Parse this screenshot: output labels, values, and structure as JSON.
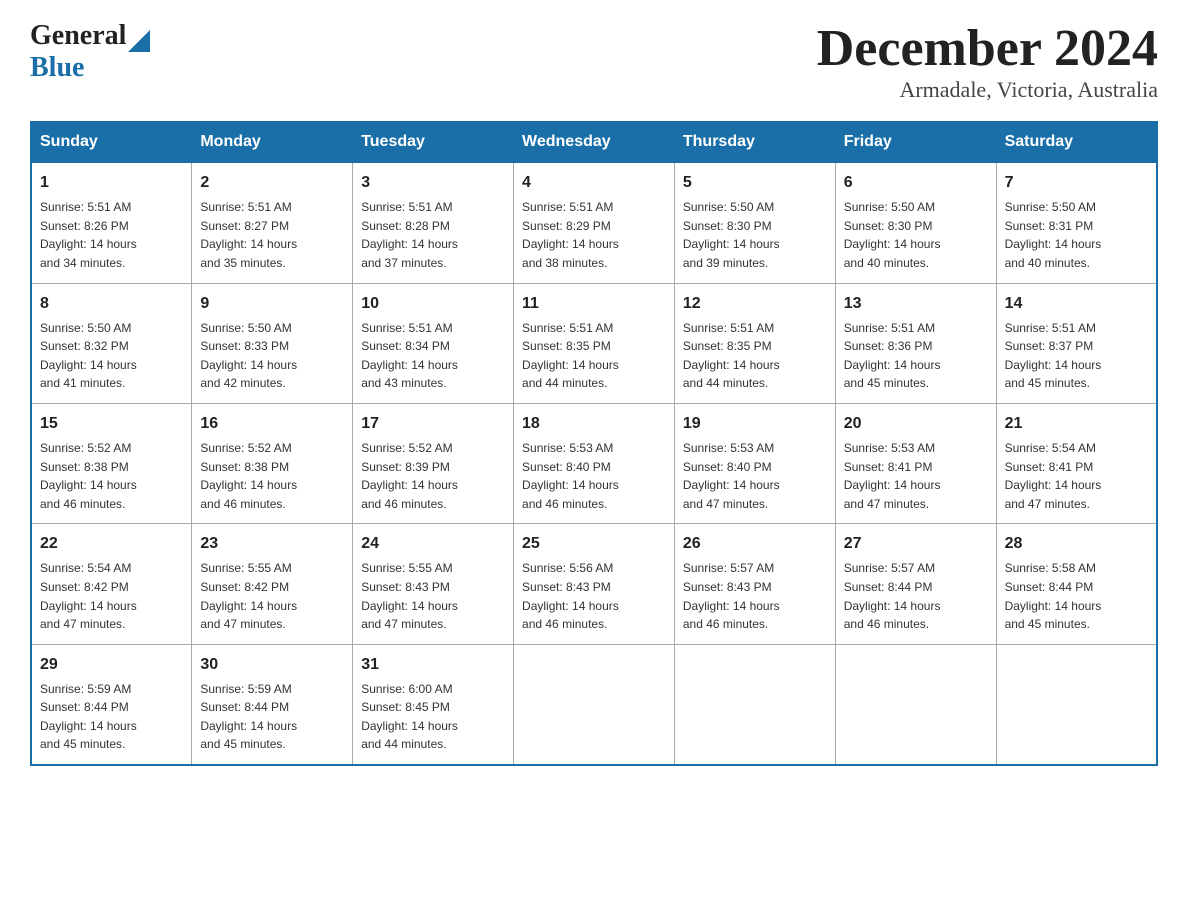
{
  "header": {
    "logo_text_general": "General",
    "logo_text_blue": "Blue",
    "title": "December 2024",
    "location": "Armadale, Victoria, Australia"
  },
  "days_of_week": [
    "Sunday",
    "Monday",
    "Tuesday",
    "Wednesday",
    "Thursday",
    "Friday",
    "Saturday"
  ],
  "weeks": [
    [
      {
        "day": "1",
        "sunrise": "5:51 AM",
        "sunset": "8:26 PM",
        "daylight": "14 hours and 34 minutes."
      },
      {
        "day": "2",
        "sunrise": "5:51 AM",
        "sunset": "8:27 PM",
        "daylight": "14 hours and 35 minutes."
      },
      {
        "day": "3",
        "sunrise": "5:51 AM",
        "sunset": "8:28 PM",
        "daylight": "14 hours and 37 minutes."
      },
      {
        "day": "4",
        "sunrise": "5:51 AM",
        "sunset": "8:29 PM",
        "daylight": "14 hours and 38 minutes."
      },
      {
        "day": "5",
        "sunrise": "5:50 AM",
        "sunset": "8:30 PM",
        "daylight": "14 hours and 39 minutes."
      },
      {
        "day": "6",
        "sunrise": "5:50 AM",
        "sunset": "8:30 PM",
        "daylight": "14 hours and 40 minutes."
      },
      {
        "day": "7",
        "sunrise": "5:50 AM",
        "sunset": "8:31 PM",
        "daylight": "14 hours and 40 minutes."
      }
    ],
    [
      {
        "day": "8",
        "sunrise": "5:50 AM",
        "sunset": "8:32 PM",
        "daylight": "14 hours and 41 minutes."
      },
      {
        "day": "9",
        "sunrise": "5:50 AM",
        "sunset": "8:33 PM",
        "daylight": "14 hours and 42 minutes."
      },
      {
        "day": "10",
        "sunrise": "5:51 AM",
        "sunset": "8:34 PM",
        "daylight": "14 hours and 43 minutes."
      },
      {
        "day": "11",
        "sunrise": "5:51 AM",
        "sunset": "8:35 PM",
        "daylight": "14 hours and 44 minutes."
      },
      {
        "day": "12",
        "sunrise": "5:51 AM",
        "sunset": "8:35 PM",
        "daylight": "14 hours and 44 minutes."
      },
      {
        "day": "13",
        "sunrise": "5:51 AM",
        "sunset": "8:36 PM",
        "daylight": "14 hours and 45 minutes."
      },
      {
        "day": "14",
        "sunrise": "5:51 AM",
        "sunset": "8:37 PM",
        "daylight": "14 hours and 45 minutes."
      }
    ],
    [
      {
        "day": "15",
        "sunrise": "5:52 AM",
        "sunset": "8:38 PM",
        "daylight": "14 hours and 46 minutes."
      },
      {
        "day": "16",
        "sunrise": "5:52 AM",
        "sunset": "8:38 PM",
        "daylight": "14 hours and 46 minutes."
      },
      {
        "day": "17",
        "sunrise": "5:52 AM",
        "sunset": "8:39 PM",
        "daylight": "14 hours and 46 minutes."
      },
      {
        "day": "18",
        "sunrise": "5:53 AM",
        "sunset": "8:40 PM",
        "daylight": "14 hours and 46 minutes."
      },
      {
        "day": "19",
        "sunrise": "5:53 AM",
        "sunset": "8:40 PM",
        "daylight": "14 hours and 47 minutes."
      },
      {
        "day": "20",
        "sunrise": "5:53 AM",
        "sunset": "8:41 PM",
        "daylight": "14 hours and 47 minutes."
      },
      {
        "day": "21",
        "sunrise": "5:54 AM",
        "sunset": "8:41 PM",
        "daylight": "14 hours and 47 minutes."
      }
    ],
    [
      {
        "day": "22",
        "sunrise": "5:54 AM",
        "sunset": "8:42 PM",
        "daylight": "14 hours and 47 minutes."
      },
      {
        "day": "23",
        "sunrise": "5:55 AM",
        "sunset": "8:42 PM",
        "daylight": "14 hours and 47 minutes."
      },
      {
        "day": "24",
        "sunrise": "5:55 AM",
        "sunset": "8:43 PM",
        "daylight": "14 hours and 47 minutes."
      },
      {
        "day": "25",
        "sunrise": "5:56 AM",
        "sunset": "8:43 PM",
        "daylight": "14 hours and 46 minutes."
      },
      {
        "day": "26",
        "sunrise": "5:57 AM",
        "sunset": "8:43 PM",
        "daylight": "14 hours and 46 minutes."
      },
      {
        "day": "27",
        "sunrise": "5:57 AM",
        "sunset": "8:44 PM",
        "daylight": "14 hours and 46 minutes."
      },
      {
        "day": "28",
        "sunrise": "5:58 AM",
        "sunset": "8:44 PM",
        "daylight": "14 hours and 45 minutes."
      }
    ],
    [
      {
        "day": "29",
        "sunrise": "5:59 AM",
        "sunset": "8:44 PM",
        "daylight": "14 hours and 45 minutes."
      },
      {
        "day": "30",
        "sunrise": "5:59 AM",
        "sunset": "8:44 PM",
        "daylight": "14 hours and 45 minutes."
      },
      {
        "day": "31",
        "sunrise": "6:00 AM",
        "sunset": "8:45 PM",
        "daylight": "14 hours and 44 minutes."
      },
      null,
      null,
      null,
      null
    ]
  ],
  "labels": {
    "sunrise": "Sunrise:",
    "sunset": "Sunset:",
    "daylight": "Daylight:"
  }
}
